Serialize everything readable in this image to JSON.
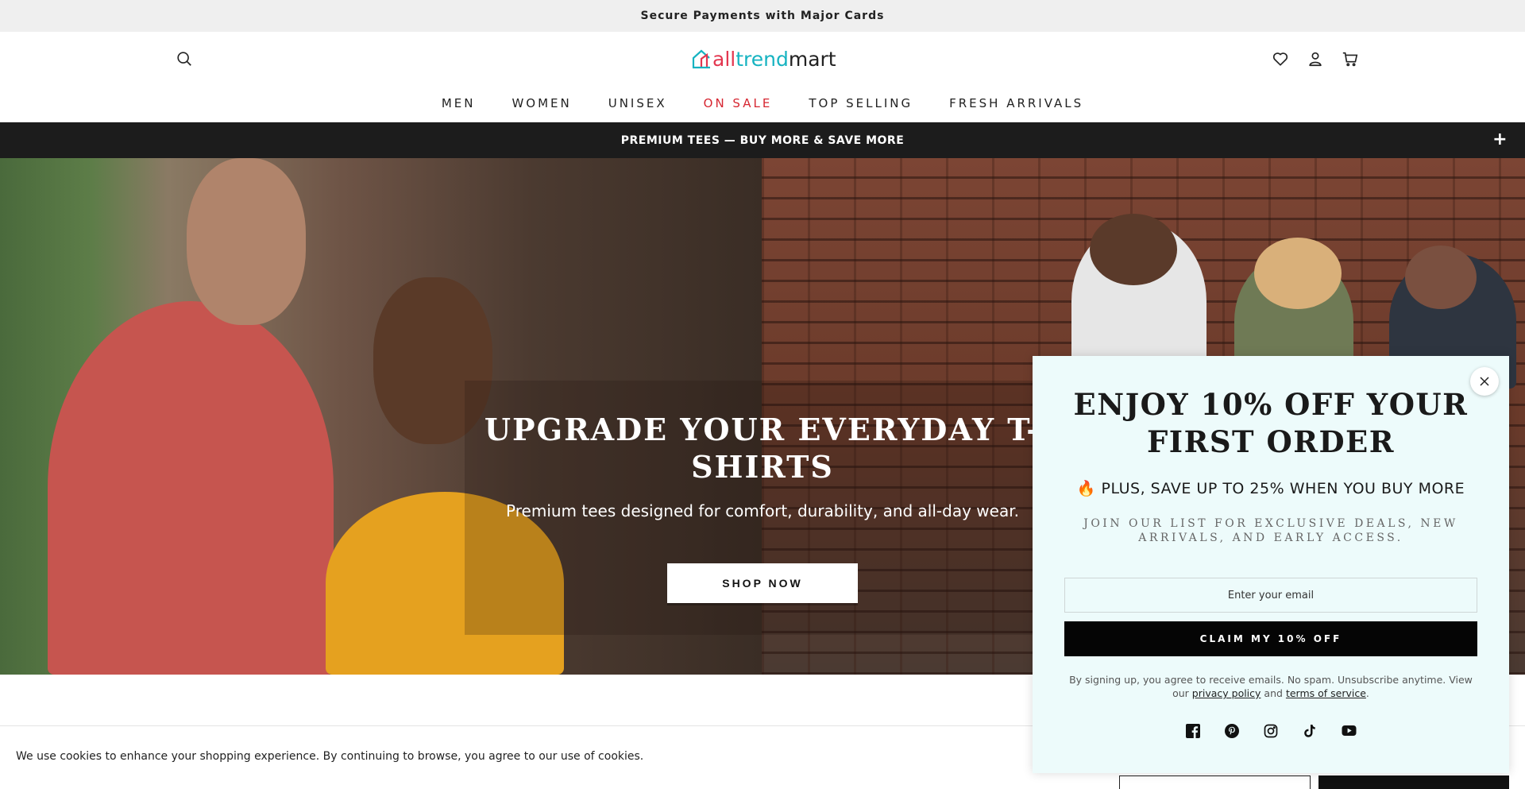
{
  "announcement": {
    "text": "Secure Payments with Major Cards"
  },
  "header": {
    "logo": {
      "part1": "all",
      "part2": "trend",
      "part3": "mart"
    },
    "icons": [
      "search-icon",
      "heart-icon",
      "user-icon",
      "cart-icon"
    ],
    "nav": [
      {
        "label": "MEN"
      },
      {
        "label": "WOMEN"
      },
      {
        "label": "UNISEX"
      },
      {
        "label": "ON SALE"
      },
      {
        "label": "TOP SELLING"
      },
      {
        "label": "FRESH ARRIVALS"
      }
    ],
    "sale_color": "#d62631"
  },
  "promo_bar": {
    "text": "PREMIUM TEES — BUY MORE & SAVE MORE",
    "toggle": "+"
  },
  "hero": {
    "title": "UPGRADE YOUR EVERYDAY T-SHIRTS",
    "subtitle": "Premium tees designed for comfort, durability, and all-day wear.",
    "cta": "SHOP NOW"
  },
  "popup": {
    "close_icon": "close-icon",
    "title": "ENJOY 10% OFF YOUR FIRST ORDER",
    "plus_line": "🔥 PLUS, SAVE UP TO 25% WHEN YOU BUY MORE",
    "join_line": "JOIN OUR LIST FOR EXCLUSIVE DEALS, NEW ARRIVALS, AND EARLY ACCESS.",
    "email_placeholder": "Enter your email",
    "button": "CLAIM MY 10% OFF",
    "legal_prefix": "By signing up, you agree to receive emails. No spam. Unsubscribe anytime. View our",
    "privacy_link": "privacy policy",
    "and_text": "and",
    "terms_link": "terms of service",
    "legal_suffix": ".",
    "socials": [
      "facebook-icon",
      "pinterest-icon",
      "instagram-icon",
      "tiktok-icon",
      "youtube-icon"
    ]
  },
  "cookie": {
    "text": "We use cookies to enhance your shopping experience. By continuing to browse, you agree to our use of cookies."
  }
}
